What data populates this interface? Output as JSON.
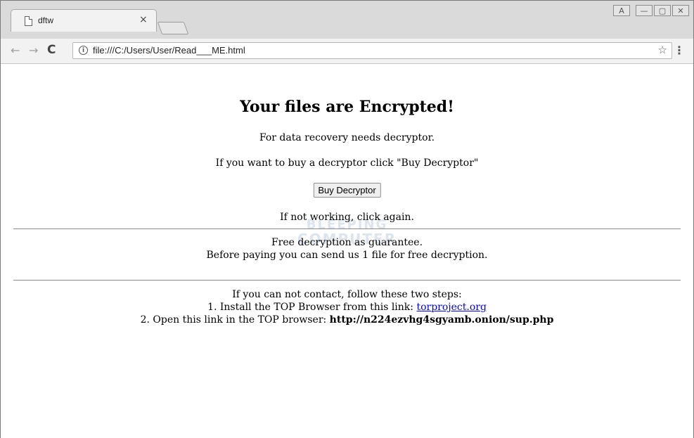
{
  "browser": {
    "tab_title": "dftw",
    "tab_close": "×",
    "url": "file:///C:/Users/User/Read___ME.html",
    "info_icon_glyph": "i",
    "star_glyph": "☆",
    "menu_glyph": "⋮",
    "back_glyph": "←",
    "forward_glyph": "→",
    "reload_glyph": "C",
    "user_glyph": "A",
    "minimize_glyph": "—",
    "restore_glyph": "▢",
    "close_glyph": "✕",
    "icons": {
      "tab": "page-icon",
      "back": "back-arrow-icon",
      "forward": "forward-arrow-icon",
      "reload": "reload-icon",
      "info": "info-icon",
      "star": "bookmark-star-icon",
      "menu": "kebab-menu-icon"
    }
  },
  "page": {
    "heading": "Your files are Encrypted!",
    "line1": "For data recovery needs decryptor.",
    "line2": "If you want to buy a decryptor click \"Buy Decryptor\"",
    "buy_button": "Buy Decryptor",
    "line3": "If not working, click again.",
    "guarantee1": "Free decryption as guarantee.",
    "guarantee2": "Before paying you can send us 1 file for free decryption.",
    "contact_intro": "If you can not contact, follow these two steps:",
    "step1_prefix": "1. Install the TOP Browser from this link: ",
    "step1_link": "torproject.org",
    "step2_prefix": "2. Open this link in the TOP browser: ",
    "step2_onion": "http://n224ezvhg4sgyamb.onion/sup.php"
  },
  "watermark": {
    "line1": "BLEEPING",
    "line2": "COMPUTER"
  },
  "colors": {
    "link": "#0000ee",
    "titlebar": "#dadada",
    "toolbar": "#f2f2f2"
  }
}
